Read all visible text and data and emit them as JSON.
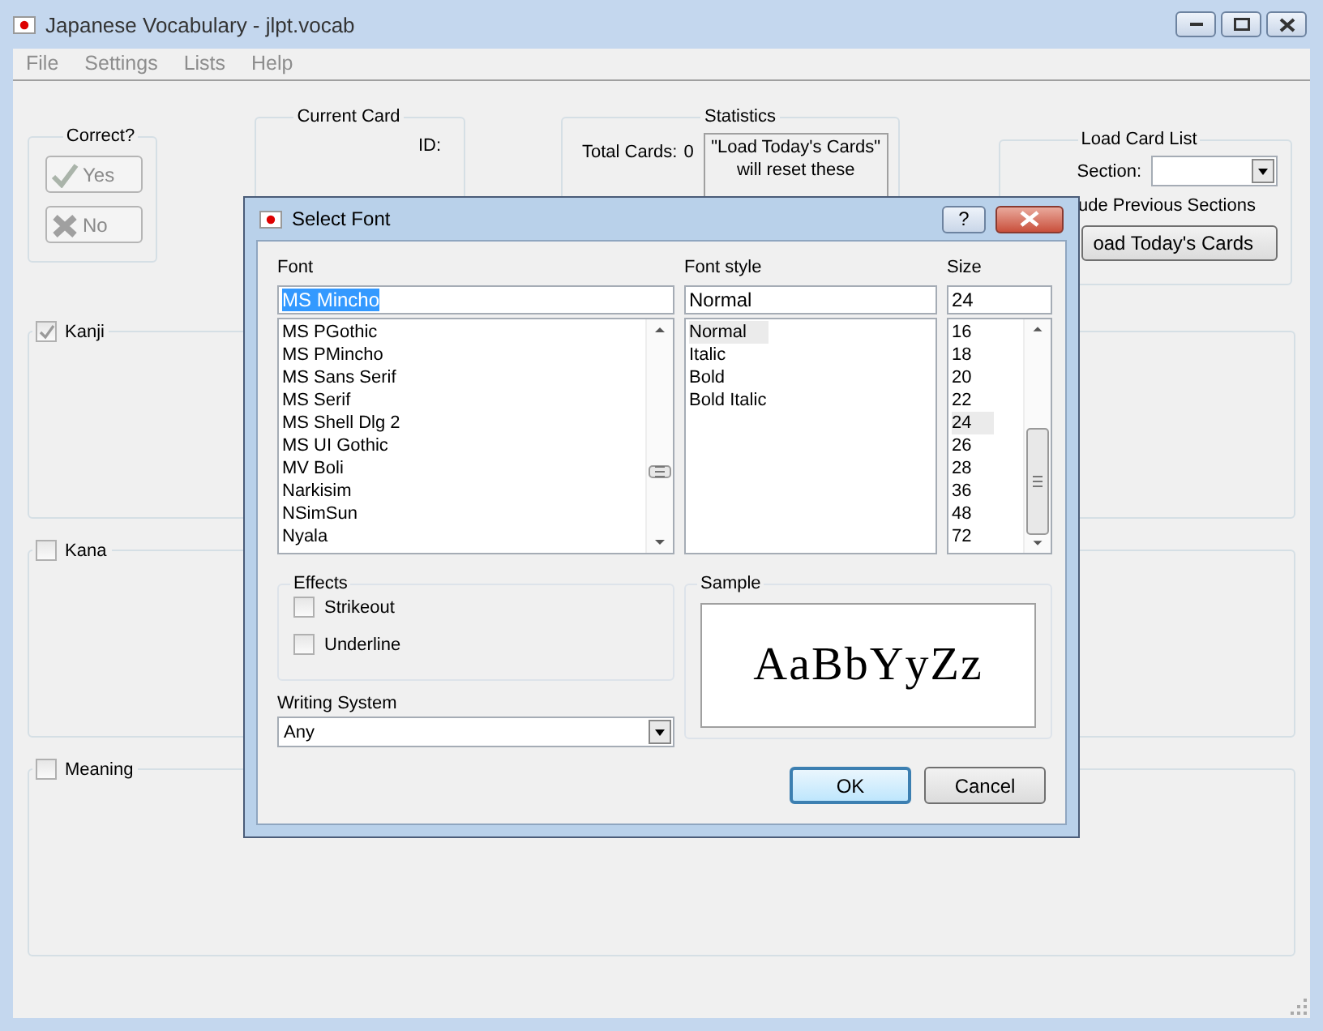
{
  "window": {
    "title": "Japanese Vocabulary - jlpt.vocab"
  },
  "menu": [
    "File",
    "Settings",
    "Lists",
    "Help"
  ],
  "correct_group": {
    "title": "Correct?",
    "buttons": [
      {
        "label": "Yes",
        "kind": "check"
      },
      {
        "label": "No",
        "kind": "cross"
      }
    ]
  },
  "current_card": {
    "title": "Current Card",
    "id_label": "ID:"
  },
  "statistics": {
    "title": "Statistics",
    "total_cards_label": "Total Cards:",
    "total_cards_value": "0",
    "note": "\"Load Today's Cards\" will reset these"
  },
  "load_card_list": {
    "title": "Load Card List",
    "section_label": "Section:",
    "include_label": "ude Previous Sections",
    "load_button": "oad Today's Cards"
  },
  "panels": [
    {
      "label": "Kanji",
      "checked": true
    },
    {
      "label": "Kana",
      "checked": false
    },
    {
      "label": "Meaning",
      "checked": false
    }
  ],
  "dialog": {
    "title": "Select Font",
    "help_button": "?",
    "font": {
      "label": "Font",
      "value": "MS Mincho",
      "items": [
        {
          "label": "MS PGothic",
          "selected": false
        },
        {
          "label": "MS PMincho",
          "selected": false
        },
        {
          "label": "MS Sans Serif",
          "selected": false
        },
        {
          "label": "MS Serif",
          "selected": false
        },
        {
          "label": "MS Shell Dlg 2",
          "selected": false
        },
        {
          "label": "MS UI Gothic",
          "selected": false
        },
        {
          "label": "MV Boli",
          "selected": false
        },
        {
          "label": "Narkisim",
          "selected": false
        },
        {
          "label": "NSimSun",
          "selected": false
        },
        {
          "label": "Nyala",
          "selected": false
        }
      ]
    },
    "style": {
      "label": "Font style",
      "value": "Normal",
      "items": [
        {
          "label": "Normal",
          "selected": true
        },
        {
          "label": "Italic",
          "selected": false
        },
        {
          "label": "Bold",
          "selected": false
        },
        {
          "label": "Bold Italic",
          "selected": false
        }
      ]
    },
    "size": {
      "label": "Size",
      "value": "24",
      "items": [
        {
          "label": "16",
          "selected": false
        },
        {
          "label": "18",
          "selected": false
        },
        {
          "label": "20",
          "selected": false
        },
        {
          "label": "22",
          "selected": false
        },
        {
          "label": "24",
          "selected": true
        },
        {
          "label": "26",
          "selected": false
        },
        {
          "label": "28",
          "selected": false
        },
        {
          "label": "36",
          "selected": false
        },
        {
          "label": "48",
          "selected": false
        },
        {
          "label": "72",
          "selected": false
        }
      ]
    },
    "effects": {
      "title": "Effects",
      "options": [
        {
          "label": "Strikeout",
          "checked": false
        },
        {
          "label": "Underline",
          "checked": false
        }
      ]
    },
    "writing_system": {
      "label": "Writing System",
      "value": "Any"
    },
    "sample": {
      "title": "Sample",
      "text": "AaBbYyZz"
    },
    "buttons": [
      {
        "label": "OK",
        "default": true
      },
      {
        "label": "Cancel",
        "default": false
      }
    ]
  }
}
